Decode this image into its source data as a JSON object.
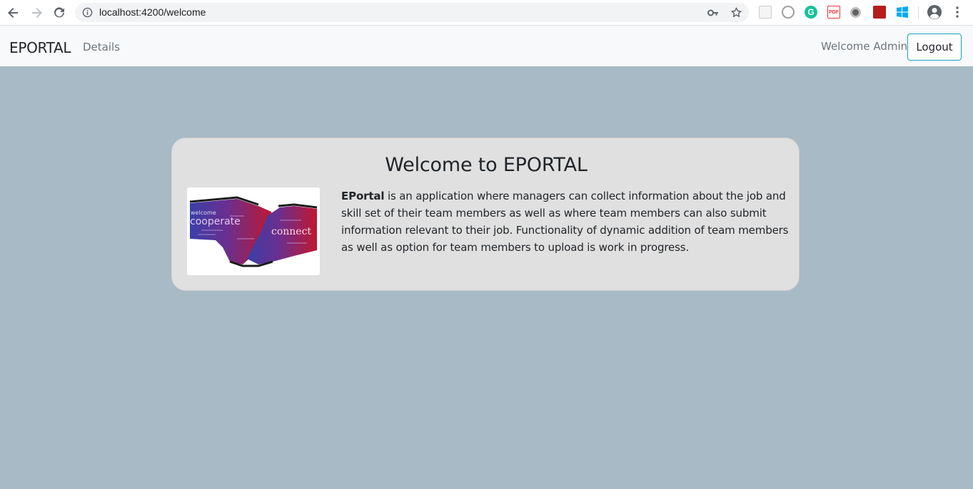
{
  "browser": {
    "url": "localhost:4200/welcome",
    "icons": {
      "back": "arrow-left-icon",
      "forward": "arrow-right-icon",
      "reload": "reload-icon",
      "site_info": "info-icon",
      "key": "key-icon",
      "bookmark": "star-icon",
      "profile": "account-circle-icon",
      "menu": "kebab-menu-icon"
    }
  },
  "navbar": {
    "brand": "EPORTAL",
    "links": [
      {
        "label": "Details"
      }
    ],
    "welcome_text": "Welcome Admin",
    "logout_label": "Logout",
    "accent_color": "#17a2b8"
  },
  "card": {
    "title": "Welcome to EPORTAL",
    "image_words": [
      "welcome",
      "cooperate",
      "connect"
    ],
    "body_strong": "EPortal",
    "body_text": " is an application where managers can collect information about the job and skill set of their team members as well as where team members can also submit information relevant to their job. Functionality of dynamic addition of team members as well as option for team members to upload is work in progress."
  },
  "colors": {
    "page_background": "#a7bac5",
    "card_background": "#e0e0e0",
    "navbar_background": "#f8f9fa"
  }
}
